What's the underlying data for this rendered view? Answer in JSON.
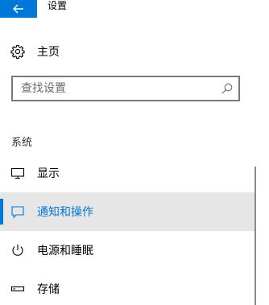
{
  "window": {
    "title": "设置"
  },
  "back_button": {
    "icon": "arrow-left-icon"
  },
  "home": {
    "label": "主页",
    "icon": "gear-icon"
  },
  "search": {
    "placeholder": "查找设置",
    "icon": "search-icon"
  },
  "section": {
    "header": "系统"
  },
  "nav": {
    "items": [
      {
        "label": "显示",
        "icon": "monitor-icon",
        "selected": false
      },
      {
        "label": "通知和操作",
        "icon": "notification-icon",
        "selected": true
      },
      {
        "label": "电源和睡眠",
        "icon": "power-icon",
        "selected": false
      },
      {
        "label": "存储",
        "icon": "storage-icon",
        "selected": false
      }
    ]
  },
  "colors": {
    "accent": "#0078d7",
    "selected_background": "#e6e6e6",
    "border": "#7a7a7a"
  }
}
